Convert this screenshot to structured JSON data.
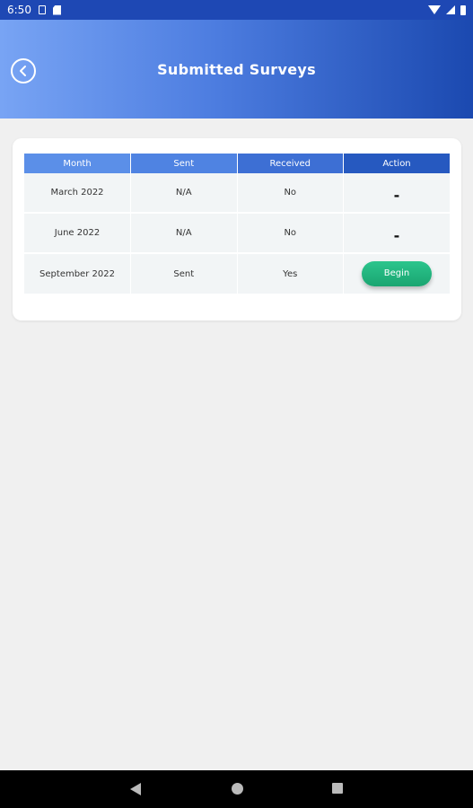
{
  "status_bar": {
    "time": "6:50",
    "icons": [
      "sim-icon",
      "sd-card-icon",
      "wifi-icon",
      "signal-icon",
      "battery-icon"
    ]
  },
  "header": {
    "title": "Submitted Surveys",
    "back_icon": "chevron-left-circle-icon",
    "gradient_colors": [
      "#78a4f4",
      "#1b49b0"
    ]
  },
  "table": {
    "columns": [
      "Month",
      "Sent",
      "Received",
      "Action"
    ],
    "rows": [
      {
        "month": "March 2022",
        "sent": "N/A",
        "received": "No",
        "action": "-"
      },
      {
        "month": "June 2022",
        "sent": "N/A",
        "received": "No",
        "action": "-"
      },
      {
        "month": "September 2022",
        "sent": "Sent",
        "received": "Yes",
        "action": "Begin"
      }
    ]
  },
  "colors": {
    "begin_button": "#1fb07a",
    "background": "#f0f0f0"
  },
  "nav_bar": {
    "icons": [
      "back-triangle-icon",
      "home-circle-icon",
      "recents-square-icon"
    ]
  }
}
